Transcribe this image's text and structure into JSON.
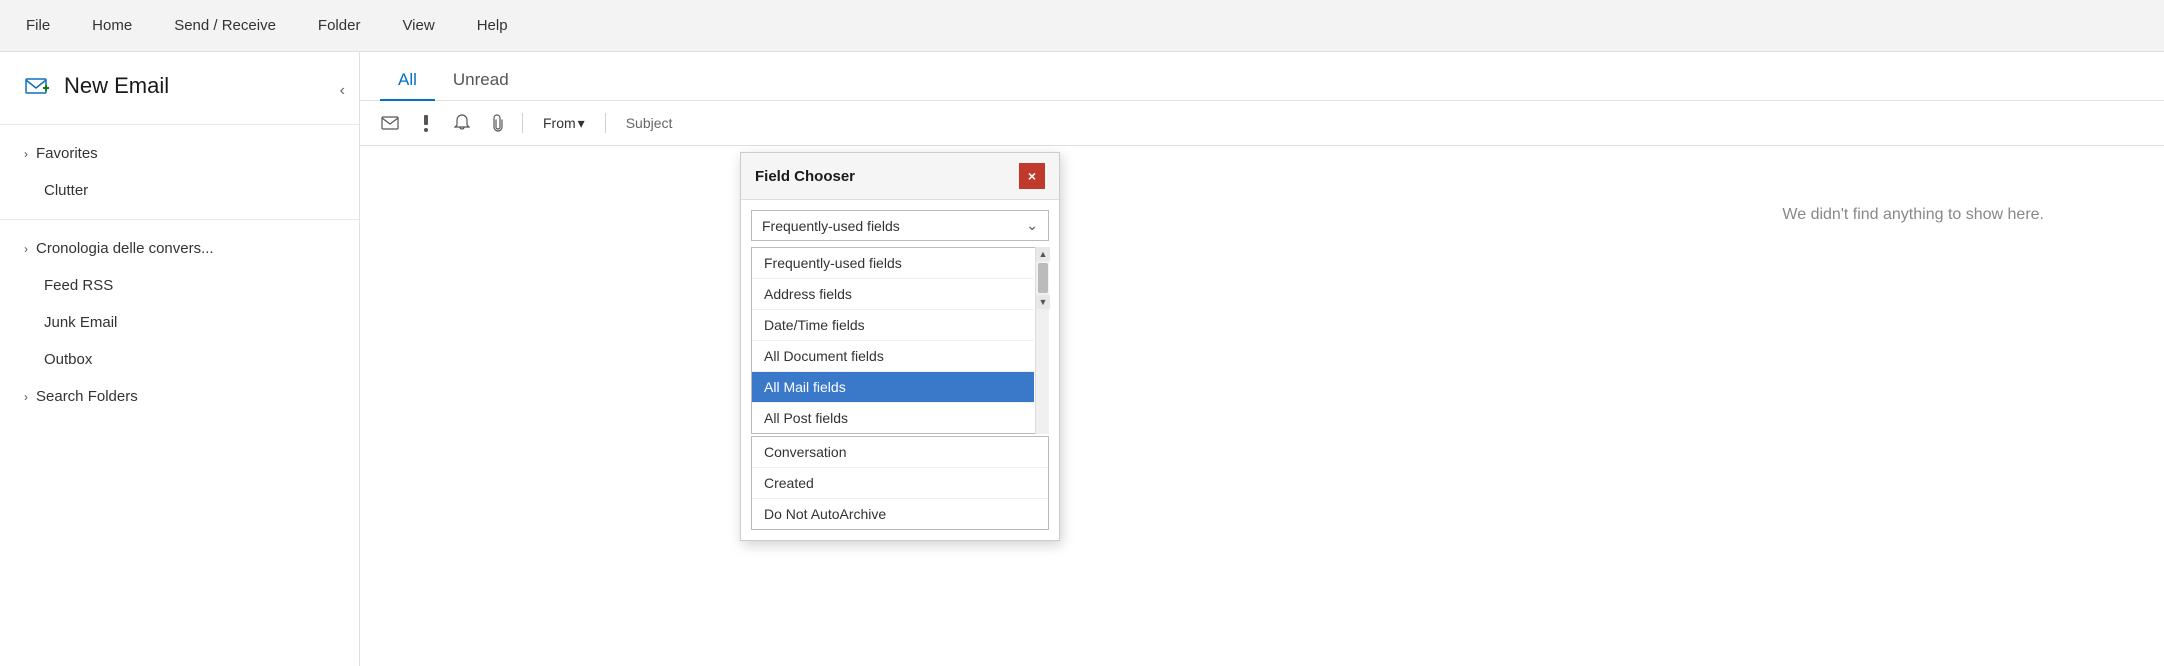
{
  "menu": {
    "items": [
      {
        "label": "File",
        "id": "file"
      },
      {
        "label": "Home",
        "id": "home"
      },
      {
        "label": "Send / Receive",
        "id": "send-receive"
      },
      {
        "label": "Folder",
        "id": "folder"
      },
      {
        "label": "View",
        "id": "view"
      },
      {
        "label": "Help",
        "id": "help"
      }
    ]
  },
  "sidebar": {
    "new_email_label": "New Email",
    "collapse_title": "Collapse",
    "items": [
      {
        "label": "Favorites",
        "type": "group",
        "id": "favorites"
      },
      {
        "label": "Clutter",
        "type": "item",
        "id": "clutter"
      },
      {
        "label": "Cronologia delle convers...",
        "type": "group",
        "id": "conversation-history"
      },
      {
        "label": "Feed RSS",
        "type": "item",
        "id": "rss"
      },
      {
        "label": "Junk Email",
        "type": "item",
        "id": "junk"
      },
      {
        "label": "Outbox",
        "type": "item",
        "id": "outbox"
      },
      {
        "label": "Search Folders",
        "type": "group",
        "id": "search-folders"
      }
    ]
  },
  "tabs": {
    "items": [
      {
        "label": "All",
        "active": true
      },
      {
        "label": "Unread",
        "active": false
      }
    ]
  },
  "filter_bar": {
    "from_label": "From",
    "from_arrow": "▾",
    "subject_label": "Subject"
  },
  "empty_state": {
    "message": "We didn't find anything to show here."
  },
  "field_chooser": {
    "title": "Field Chooser",
    "close_label": "×",
    "dropdown_selected": "Frequently-used fields",
    "dropdown_items": [
      {
        "label": "Frequently-used fields",
        "selected": false
      },
      {
        "label": "Address fields",
        "selected": false
      },
      {
        "label": "Date/Time fields",
        "selected": false
      },
      {
        "label": "All Document fields",
        "selected": false
      },
      {
        "label": "All Mail fields",
        "selected": true
      },
      {
        "label": "All Post fields",
        "selected": false
      }
    ],
    "list_items": [
      {
        "label": "Conversation"
      },
      {
        "label": "Created"
      },
      {
        "label": "Do Not AutoArchive"
      }
    ]
  }
}
